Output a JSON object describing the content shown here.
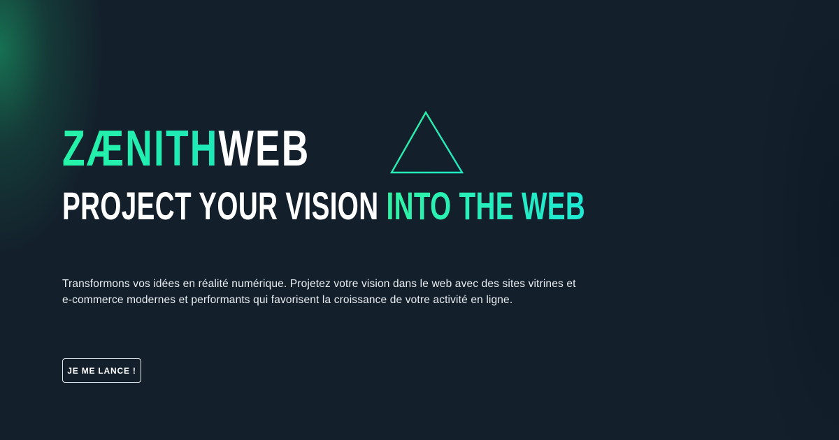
{
  "brand": {
    "primary": "ZÆNITH",
    "secondary": "WEB",
    "logo_icon": "pyramid-icon"
  },
  "tagline": {
    "part1": "PROJECT YOUR VISION",
    "part2": "INTO THE WEB"
  },
  "description": "Transformons vos idées en réalité numérique. Projetez votre vision dans le web avec des sites vitrines et e-commerce modernes et performants qui favorisent la croissance de votre activité en ligne.",
  "cta": {
    "label": "JE ME LANCE !"
  },
  "colors": {
    "background": "#131f2b",
    "accent_green": "#22f0ae",
    "accent_teal": "#1ee9d4",
    "text": "#ffffff"
  }
}
